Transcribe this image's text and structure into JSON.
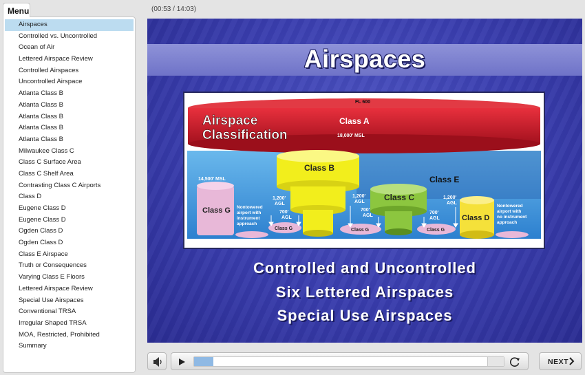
{
  "menu": {
    "tab_label": "Menu",
    "items": [
      "Airspaces",
      "Controlled vs. Uncontrolled",
      "Ocean of Air",
      "Lettered Airspace Review",
      "Controlled Airspaces",
      "Uncontrolled Airspace",
      "Atlanta Class B",
      "Atlanta Class B",
      "Atlanta Class B",
      "Atlanta Class B",
      "Atlanta Class B",
      "Milwaukee Class C",
      "Class C Surface Area",
      "Class C Shelf Area",
      "Contrasting Class C Airports",
      "Class D",
      "Eugene Class D",
      "Eugene Class D",
      "Ogden Class D",
      "Ogden Class D",
      "Class E Airspace",
      "Truth or Consequences",
      "Varying Class E Floors",
      "Lettered Airspace Review",
      "Special Use Airspaces",
      "Conventional TRSA",
      "Irregular Shaped TRSA",
      "MOA, Restricted, Prohibited",
      "Summary"
    ],
    "active_index": 0
  },
  "player": {
    "time": "(00:53 / 14:03)",
    "progress_fraction": 0.063,
    "next_label": "NEXT"
  },
  "slide": {
    "title": "Airspaces",
    "bullets": [
      "Controlled and Uncontrolled",
      "Six Lettered Airspaces",
      "Special Use Airspaces"
    ],
    "diagram": {
      "fl600": "FL 600",
      "heading1": "Airspace",
      "heading2": "Classification",
      "class_a": "Class A",
      "msl18000": "18,000' MSL",
      "class_b": "Class B",
      "class_c": "Class C",
      "class_d": "Class D",
      "class_e": "Class E",
      "class_g": "Class G",
      "msl14500": "14,500' MSL",
      "agl1200": "1,200'",
      "agl700": "700'",
      "agl": "AGL",
      "class_g_small": "Class G",
      "nontowered_1": "Nontowered",
      "nontowered_2": "airport with",
      "nontowered_3": "instrument",
      "nontowered_4": "approach",
      "nontowered_no_1": "Nontowered",
      "nontowered_no_2": "airport with",
      "nontowered_no_3": "no instrument",
      "nontowered_no_4": "approach"
    }
  },
  "colors": {
    "accent_selected": "#bcdcf0",
    "slide_blue": "#3b3fb0",
    "class_a_red": "#c8202e",
    "class_b_yellow": "#f2ee1c",
    "class_c_green": "#8cc63f",
    "class_d_yellow": "#f5e13a",
    "class_e_blue": "#2f8fd8",
    "class_g_pink": "#e8b8d8"
  },
  "icons": {
    "mute": "speaker-icon",
    "play": "play-icon",
    "replay": "replay-icon",
    "next": "chevron-right-icon"
  }
}
